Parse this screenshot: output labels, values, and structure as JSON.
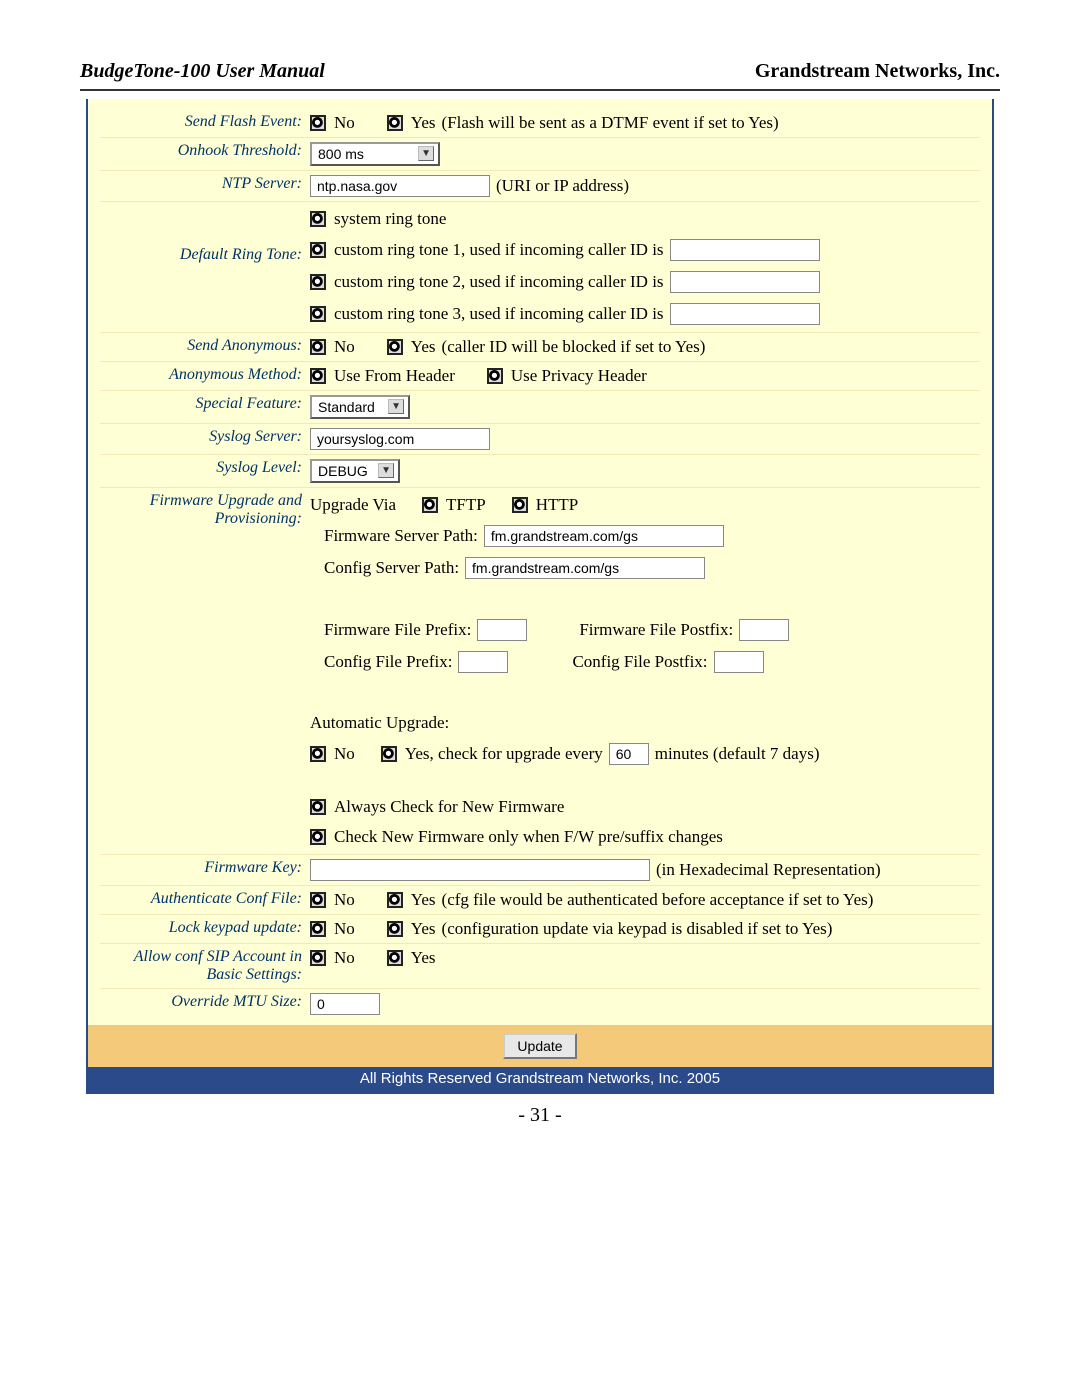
{
  "header": {
    "title_left": "BudgeTone-100 User Manual",
    "title_right": "Grandstream Networks, Inc."
  },
  "rows": {
    "send_flash_event": {
      "label": "Send Flash Event:",
      "opt_no": "No",
      "opt_yes": "Yes",
      "hint": "(Flash will be sent as a DTMF event if set to Yes)"
    },
    "onhook_threshold": {
      "label": "Onhook Threshold:",
      "value": "800 ms"
    },
    "ntp_server": {
      "label": "NTP Server:",
      "value": "ntp.nasa.gov",
      "hint": "(URI or IP address)"
    },
    "default_ring_tone": {
      "label": "Default Ring Tone:",
      "opt_system": "system ring tone",
      "opt_c1": "custom ring tone 1, used if incoming caller ID is",
      "opt_c2": "custom ring tone 2, used if incoming caller ID is",
      "opt_c3": "custom ring tone 3, used if incoming caller ID is"
    },
    "send_anonymous": {
      "label": "Send Anonymous:",
      "opt_no": "No",
      "opt_yes": "Yes",
      "hint": "(caller ID will be blocked if set to Yes)"
    },
    "anonymous_method": {
      "label": "Anonymous Method:",
      "opt_from": "Use From Header",
      "opt_privacy": "Use Privacy Header"
    },
    "special_feature": {
      "label": "Special Feature:",
      "value": "Standard"
    },
    "syslog_server": {
      "label": "Syslog Server:",
      "value": "yoursyslog.com"
    },
    "syslog_level": {
      "label": "Syslog Level:",
      "value": "DEBUG"
    },
    "firmware_provisioning": {
      "label": "Firmware Upgrade and Provisioning:",
      "upgrade_via": "Upgrade Via",
      "tftp": "TFTP",
      "http": "HTTP",
      "fw_server_path_label": "Firmware Server Path:",
      "fw_server_path_value": "fm.grandstream.com/gs",
      "cfg_server_path_label": "Config Server Path:",
      "cfg_server_path_value": "fm.grandstream.com/gs",
      "fw_file_prefix_label": "Firmware File Prefix:",
      "fw_file_postfix_label": "Firmware File Postfix:",
      "cfg_file_prefix_label": "Config File Prefix:",
      "cfg_file_postfix_label": "Config File Postfix:",
      "auto_upgrade_label": "Automatic Upgrade:",
      "auto_no": "No",
      "auto_yes_pre": "Yes, check for upgrade every",
      "auto_minutes_value": "60",
      "auto_yes_post": "minutes (default 7 days)",
      "always_check": "Always Check for New Firmware",
      "check_suffix": "Check New Firmware only when F/W pre/suffix changes"
    },
    "firmware_key": {
      "label": "Firmware Key:",
      "hint": "(in Hexadecimal Representation)"
    },
    "auth_conf_file": {
      "label": "Authenticate Conf File:",
      "opt_no": "No",
      "opt_yes": "Yes",
      "hint": "(cfg file would be authenticated before acceptance if set to Yes)"
    },
    "lock_keypad": {
      "label": "Lock keypad update:",
      "opt_no": "No",
      "opt_yes": "Yes",
      "hint": "(configuration update via keypad is disabled if set to Yes)"
    },
    "allow_sip_basic": {
      "label": "Allow conf SIP Account in Basic Settings:",
      "opt_no": "No",
      "opt_yes": "Yes"
    },
    "override_mtu": {
      "label": "Override MTU Size:",
      "value": "0"
    }
  },
  "button_bar": {
    "update": "Update"
  },
  "footer": {
    "copyright": "All Rights Reserved Grandstream Networks, Inc. 2005",
    "page_num": "- 31 -"
  }
}
